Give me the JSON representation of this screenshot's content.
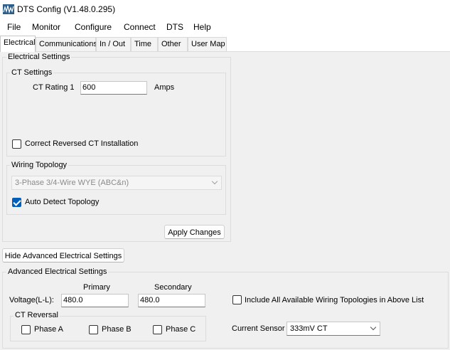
{
  "window": {
    "title": "DTS Config (V1.48.0.295)",
    "icon": "app-waveform-icon"
  },
  "menu": [
    "File",
    "Monitor",
    "Configure",
    "Connect",
    "DTS",
    "Help"
  ],
  "tabs": [
    {
      "label": "Electrical",
      "active": true
    },
    {
      "label": "Communications",
      "active": false
    },
    {
      "label": "In / Out",
      "active": false
    },
    {
      "label": "Time",
      "active": false
    },
    {
      "label": "Other",
      "active": false
    },
    {
      "label": "User Map",
      "active": false
    }
  ],
  "electrical": {
    "group_label": "Electrical Settings",
    "ct_settings": {
      "label": "CT Settings",
      "rating_label": "CT Rating 1",
      "rating_value": "600",
      "unit": "Amps",
      "reversed_label": "Correct Reversed CT Installation",
      "reversed_checked": false
    },
    "wiring": {
      "label": "Wiring Topology",
      "selected": "3-Phase 3/4-Wire WYE (ABC&n)",
      "auto_detect_label": "Auto Detect Topology",
      "auto_detect_checked": true
    },
    "apply_button": "Apply Changes"
  },
  "hide_advanced_button": "Hide Advanced Electrical Settings",
  "advanced": {
    "group_label": "Advanced Electrical Settings",
    "primary_label": "Primary",
    "secondary_label": "Secondary",
    "voltage_label": "Voltage(L-L):",
    "primary_value": "480.0",
    "secondary_value": "480.0",
    "include_topologies_label": "Include All Available Wiring Topologies in Above List",
    "include_topologies_checked": false,
    "ct_reversal": {
      "label": "CT Reversal",
      "phase_a": "Phase A",
      "phase_b": "Phase B",
      "phase_c": "Phase C"
    },
    "current_sensor_label": "Current Sensor",
    "current_sensor_value": "333mV CT"
  },
  "colors": {
    "accent": "#005fb8",
    "panel": "#f0f0f0"
  }
}
